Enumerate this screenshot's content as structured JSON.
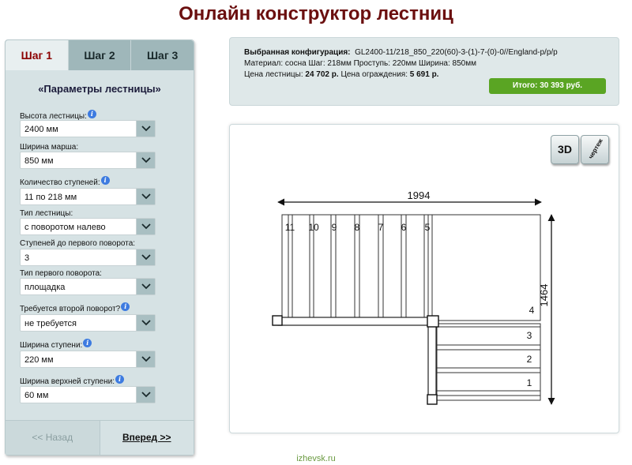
{
  "page": {
    "title": "Онлайн конструктор лестниц",
    "footer": "izhevsk.ru"
  },
  "tabs": [
    {
      "label": "Шаг 1",
      "active": true
    },
    {
      "label": "Шаг 2",
      "active": false
    },
    {
      "label": "Шаг 3",
      "active": false
    }
  ],
  "panel": {
    "heading": "«Параметры лестницы»",
    "fields": [
      {
        "label": "Высота лестницы:",
        "value": "2400 мм",
        "info": true
      },
      {
        "label": "Ширина марша:",
        "value": "850 мм",
        "info": false
      },
      {
        "label": "Количество ступеней:",
        "value": "11 по 218 мм",
        "info": true
      },
      {
        "label": "Тип лестницы:",
        "value": "с поворотом налево",
        "info": false
      },
      {
        "label": "Ступеней до первого поворота:",
        "value": "3",
        "info": false
      },
      {
        "label": "Тип первого поворота:",
        "value": "площадка",
        "info": false
      },
      {
        "label": "Требуется второй поворот?",
        "value": "не требуется",
        "info": true
      },
      {
        "label": "Ширина ступени:",
        "value": "220 мм",
        "info": true
      },
      {
        "label": "Ширина верхней ступени:",
        "value": "60 мм",
        "info": true
      }
    ],
    "info_icon": "i"
  },
  "nav": {
    "back_label": "<< Назад",
    "next_label": "Вперед >>"
  },
  "summary": {
    "config_label": "Выбранная конфигурация:",
    "config_value": "GL2400-11/218_850_220(60)-3-(1)-7-(0)-0//England-p/p/p",
    "material_line": "Материал: сосна Шаг: 218мм Проступь: 220мм Ширина: 850мм",
    "price_label": "Цена лестницы:",
    "price_value": "24 702 р.",
    "railing_label": "Цена ограждения:",
    "railing_value": "5 691 р.",
    "total": "Итого: 30 393 руб."
  },
  "view_buttons": {
    "three_d": "3D",
    "drawing": "чертеж"
  },
  "drawing": {
    "width_dimension": "1994",
    "height_dimension": "1464",
    "upper_step_numbers": [
      "11",
      "10",
      "9",
      "8",
      "7",
      "6",
      "5"
    ],
    "lower_step_numbers": [
      "4",
      "3",
      "2",
      "1"
    ]
  },
  "colors": {
    "title": "#6b0f0f",
    "active_tab_text": "#8b0000",
    "panel_bg": "#d6e2e4",
    "tab_bg": "#9fb7ba",
    "total_badge": "#5aa523",
    "info_icon": "#3d7be0"
  },
  "icons": {
    "info": "info-icon",
    "dropdown": "chevron-down-icon"
  }
}
